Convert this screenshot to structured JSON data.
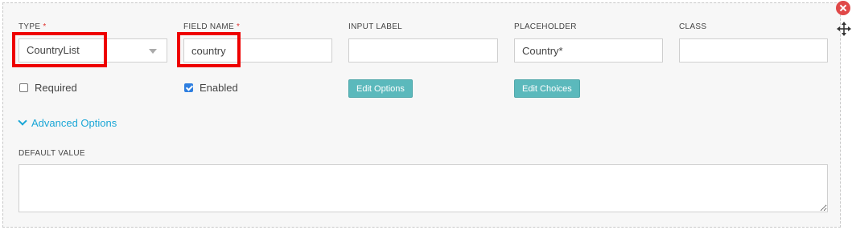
{
  "fields": {
    "type": {
      "label": "TYPE",
      "required_mark": "*",
      "value": "CountryList"
    },
    "field_name": {
      "label": "FIELD NAME",
      "required_mark": "*",
      "value": "country"
    },
    "input_label": {
      "label": "INPUT LABEL",
      "value": ""
    },
    "placeholder": {
      "label": "PLACEHOLDER",
      "value": "Country*"
    },
    "class": {
      "label": "CLASS",
      "value": ""
    }
  },
  "checkboxes": {
    "required": {
      "label": "Required",
      "checked": false
    },
    "enabled": {
      "label": "Enabled",
      "checked": true
    }
  },
  "buttons": {
    "edit_options": "Edit Options",
    "edit_choices": "Edit Choices"
  },
  "advanced": {
    "label": "Advanced Options",
    "icon": "chevron-down-icon"
  },
  "default_value": {
    "label": "DEFAULT VALUE",
    "value": ""
  },
  "controls": {
    "close_icon": "close-icon",
    "move_icon": "move-icon"
  },
  "colors": {
    "accent_button": "#5bb9bc",
    "link": "#1aa6d6",
    "required_mark": "#e0322f",
    "highlight_box": "#ee0000",
    "close": "#e04848",
    "checkbox_on": "#2f7fe0"
  }
}
